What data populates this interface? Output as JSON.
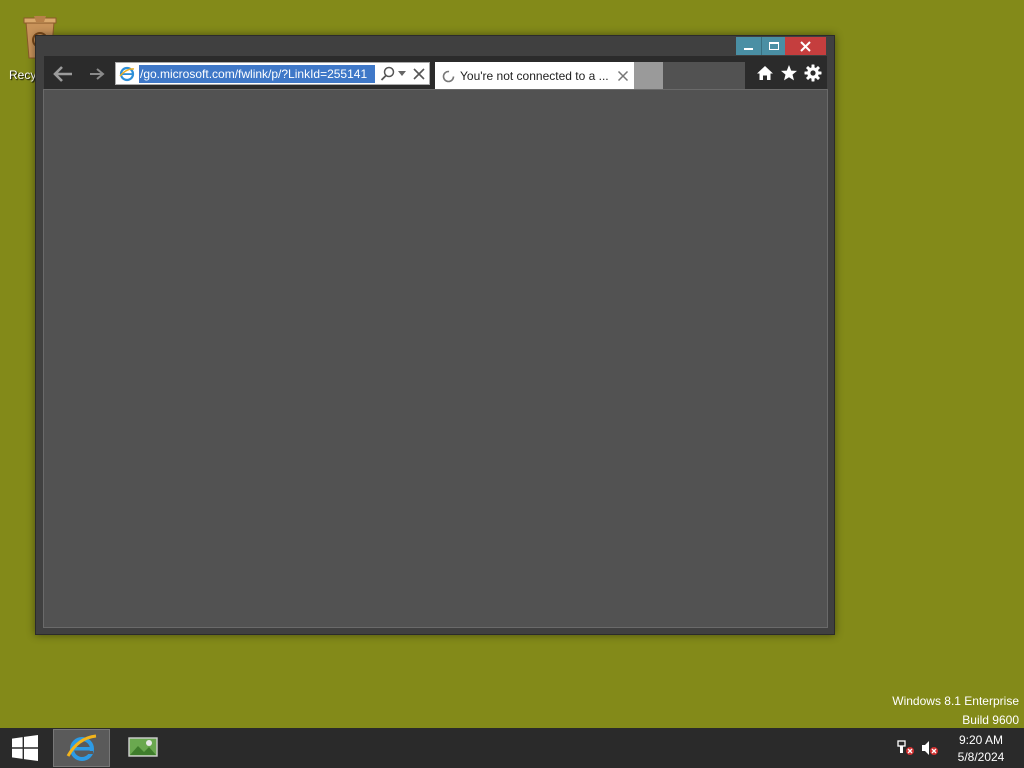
{
  "desktop": {
    "recycle_bin_label": "Recy",
    "background_color": "#838a19"
  },
  "browser": {
    "address": "/go.microsoft.com/fwlink/p/?LinkId=255141",
    "tab_title": "You're not connected to a ...",
    "caption_colors": {
      "minimize": "#4a8fa4",
      "close": "#c53e3e"
    }
  },
  "watermark": {
    "line1": "Windows 8.1 Enterprise",
    "line2": "Build 9600"
  },
  "taskbar": {
    "time": "9:20 AM",
    "date": "5/8/2024",
    "icons": [
      "windows-logo",
      "internet-explorer",
      "desktop-app"
    ]
  },
  "tray_icons": [
    "network-disconnected",
    "volume-muted"
  ]
}
